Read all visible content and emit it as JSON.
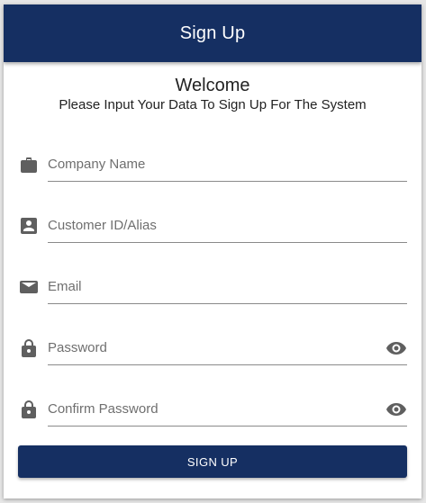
{
  "header": {
    "title": "Sign Up",
    "color": "#152f62"
  },
  "intro": {
    "welcome": "Welcome",
    "subtitle": "Please Input Your Data To Sign Up For The System"
  },
  "form": {
    "company": {
      "placeholder": "Company Name",
      "value": "",
      "icon": "briefcase-icon"
    },
    "customer": {
      "placeholder": "Customer ID/Alias",
      "value": "",
      "icon": "account-box-icon"
    },
    "email": {
      "placeholder": "Email",
      "value": "",
      "icon": "mail-icon"
    },
    "password": {
      "placeholder": "Password",
      "value": "",
      "icon": "lock-icon",
      "toggle_icon": "eye-icon"
    },
    "confirm_password": {
      "placeholder": "Confirm Password",
      "value": "",
      "icon": "lock-icon",
      "toggle_icon": "eye-icon"
    }
  },
  "actions": {
    "signup_label": "SIGN UP"
  },
  "colors": {
    "accent": "#152f62",
    "icon": "#5f5f5f"
  }
}
